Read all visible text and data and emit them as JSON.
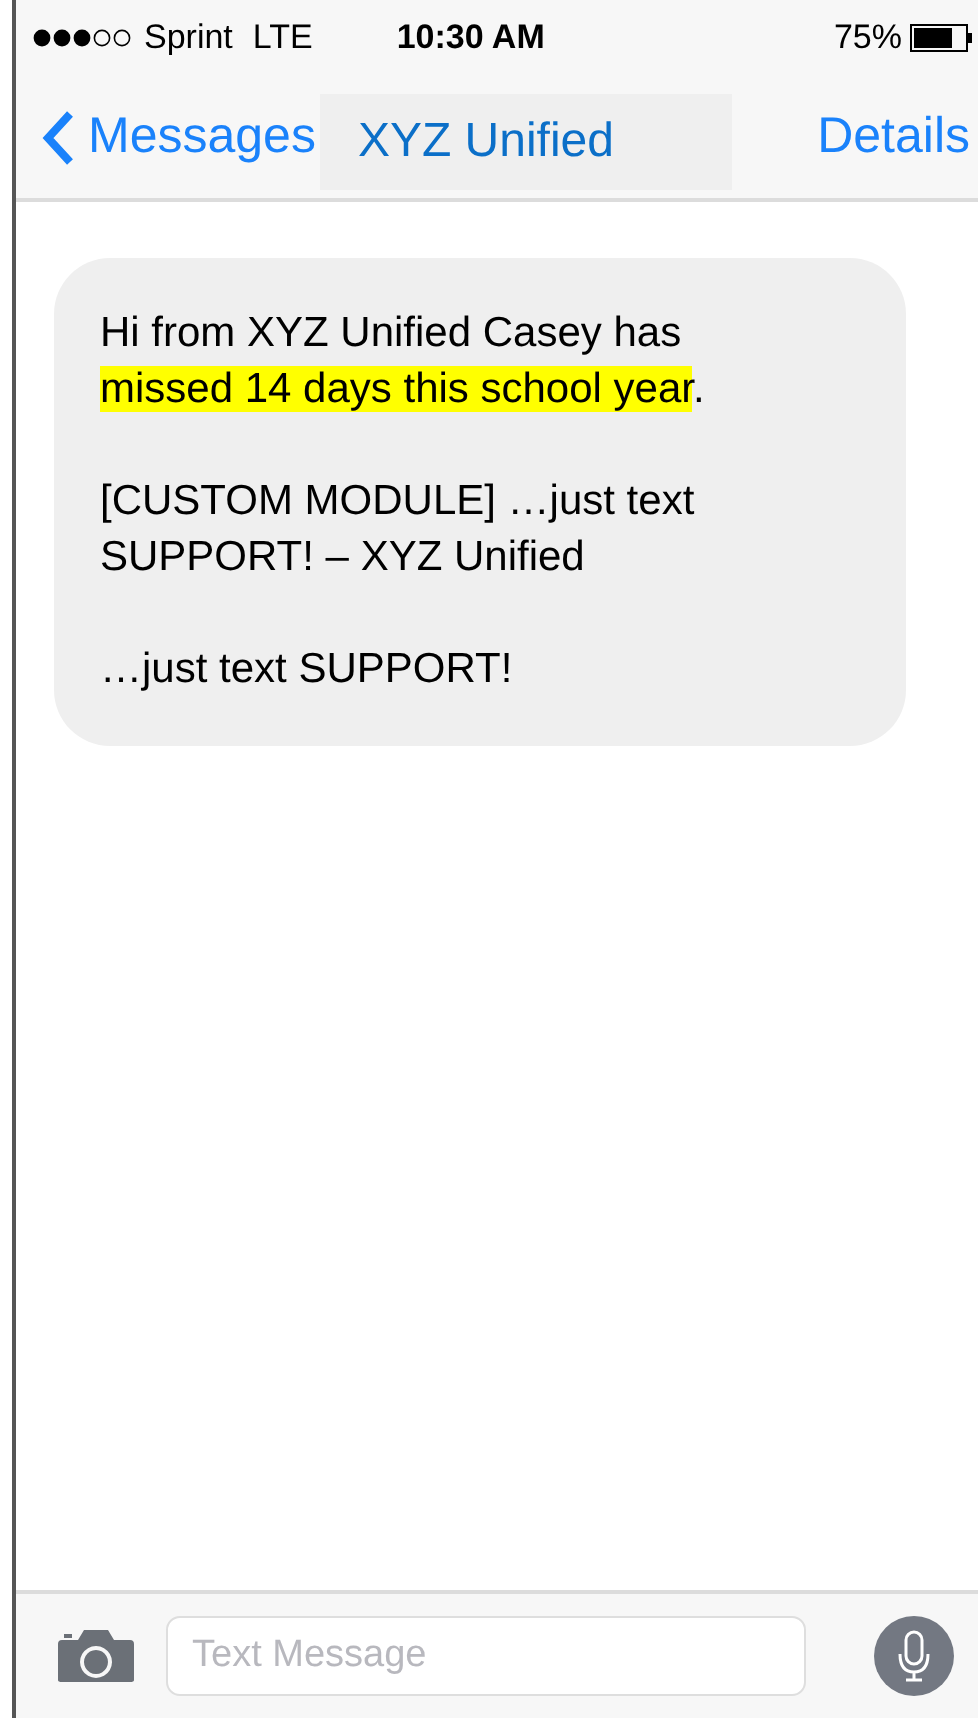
{
  "status_bar": {
    "carrier": "Sprint",
    "network": "LTE",
    "time": "10:30 AM",
    "battery": "75%"
  },
  "nav_bar": {
    "back": "Messages",
    "title": "XYZ Unified",
    "action": "Details"
  },
  "messages": [
    {
      "paragraphs": [
        [
          {
            "text": "Hi from XYZ Unified Casey has ",
            "highlighted": false
          },
          {
            "text": "missed 14 days this school year",
            "highlighted": true
          },
          {
            "text": ".",
            "highlighted": false
          }
        ],
        [
          {
            "text": "[CUSTOM MODULE] …just text SUPPORT! – XYZ Unified",
            "highlighted": false
          }
        ],
        [
          {
            "text": "…just text SUPPORT!",
            "highlighted": false
          }
        ]
      ]
    }
  ],
  "composer": {
    "placeholder": "Text Message"
  }
}
